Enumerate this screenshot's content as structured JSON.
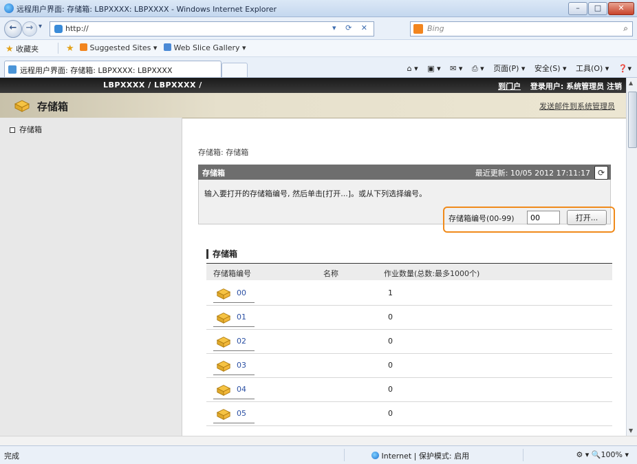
{
  "window": {
    "title": "远程用户界面: 存储箱: LBPXXXX: LBPXXXX - Windows Internet Explorer",
    "minimize_glyph": "–",
    "maximize_glyph": "□",
    "close_glyph": "✕"
  },
  "address_bar": {
    "url": "http://",
    "nav_icons": "▾ ⟳ ✕",
    "search_placeholder": "Bing",
    "search_icon": "⌕",
    "dropdown_glyph": "▾"
  },
  "favorites_bar": {
    "favorites_label": "收藏夹",
    "suggested_sites": "Suggested Sites ▾",
    "web_slice_gallery": "Web Slice Gallery ▾"
  },
  "tab": {
    "title": "远程用户界面: 存储箱: LBPXXXX: LBPXXXX"
  },
  "command_bar": {
    "home": "⌂ ▾",
    "feeds": "▣ ▾",
    "mail": "✉ ▾",
    "print": "⎙ ▾",
    "page": "页面(P) ▾",
    "safety": "安全(S) ▾",
    "tools": "工具(O) ▾",
    "help": "❓▾"
  },
  "app": {
    "model": "LBPXXXX / LBPXXXX /",
    "portal_link": "到门户",
    "login_user": "登录用户: 系统管理员",
    "logout": "注销",
    "section_title": "存储箱",
    "mail_admin_link": "发送邮件到系统管理员"
  },
  "sidebar": {
    "items": [
      {
        "label": "存储箱"
      }
    ]
  },
  "main": {
    "breadcrumb": "存储箱: 存储箱",
    "panel_title": "存储箱",
    "last_updated": "最近更新: 10/05 2012 17:11:17",
    "refresh_icon": "⟳",
    "instruction": "输入要打开的存储箱编号, 然后单击[打开...]。或从下列选择编号。",
    "box_number_label": "存储箱编号(00-99)",
    "box_number_value": "00",
    "open_button": "打开..."
  },
  "list": {
    "title": "存储箱",
    "columns": [
      "存储箱编号",
      "名称",
      "作业数量(总数:最多1000个)"
    ],
    "rows": [
      {
        "number": "00",
        "name": "",
        "jobs": "1"
      },
      {
        "number": "01",
        "name": "",
        "jobs": "0"
      },
      {
        "number": "02",
        "name": "",
        "jobs": "0"
      },
      {
        "number": "03",
        "name": "",
        "jobs": "0"
      },
      {
        "number": "04",
        "name": "",
        "jobs": "0"
      },
      {
        "number": "05",
        "name": "",
        "jobs": "0"
      }
    ]
  },
  "status_bar": {
    "status": "完成",
    "zone": "Internet | 保护模式: 启用",
    "zoom": "⚙ ▾   🔍100%  ▾"
  },
  "colors": {
    "highlight": "#f08a1a",
    "header_dark": "#1a1a1a",
    "panel_head": "#6e6e6e",
    "link": "#2a4fa3"
  }
}
